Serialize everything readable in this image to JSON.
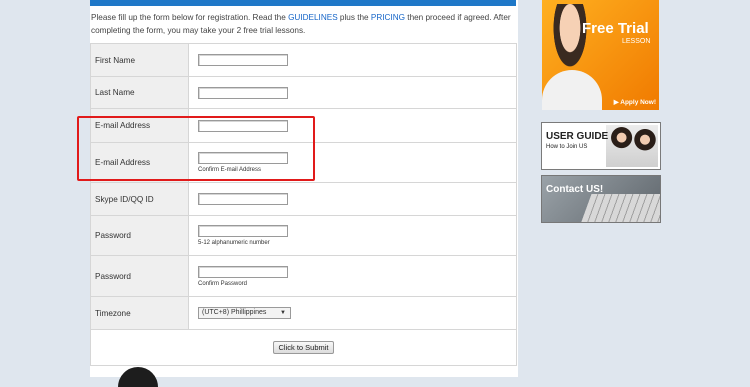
{
  "intro": {
    "p1": "Please fill up the form below for registration. Read the ",
    "guidelines": "GUIDELINES",
    "p2": " plus the ",
    "pricing": "PRICING",
    "p3": " then proceed if agreed. After completing the form, you may take your 2 free trial lessons."
  },
  "form": {
    "first_name": {
      "label": "First Name",
      "value": ""
    },
    "last_name": {
      "label": "Last Name",
      "value": ""
    },
    "email": {
      "label": "E-mail Address",
      "value": ""
    },
    "email_confirm": {
      "label": "E-mail Address",
      "value": "",
      "hint": "Confirm E-mail Address"
    },
    "skype": {
      "label": "Skype ID/QQ ID",
      "value": ""
    },
    "password": {
      "label": "Password",
      "value": "",
      "hint": "5-12 alphanumeric number"
    },
    "password_confirm": {
      "label": "Password",
      "value": "",
      "hint": "Confirm Password"
    },
    "timezone": {
      "label": "Timezone",
      "selected": "(UTC+8) Phillippines",
      "arrow": "▼"
    },
    "submit_label": "Click to Submit"
  },
  "ads": {
    "trial_title": "Free Trial",
    "trial_sub": "LESSON",
    "trial_apply": "▶ Apply Now!",
    "guide_title": "USER GUIDE",
    "guide_sub": "How to Join US",
    "contact_title": "Contact US!"
  },
  "colors": {
    "link": "#1565c8",
    "highlight": "#e11a1a",
    "trial_orange": "#f07a00",
    "top_strip": "#1f78c8"
  }
}
